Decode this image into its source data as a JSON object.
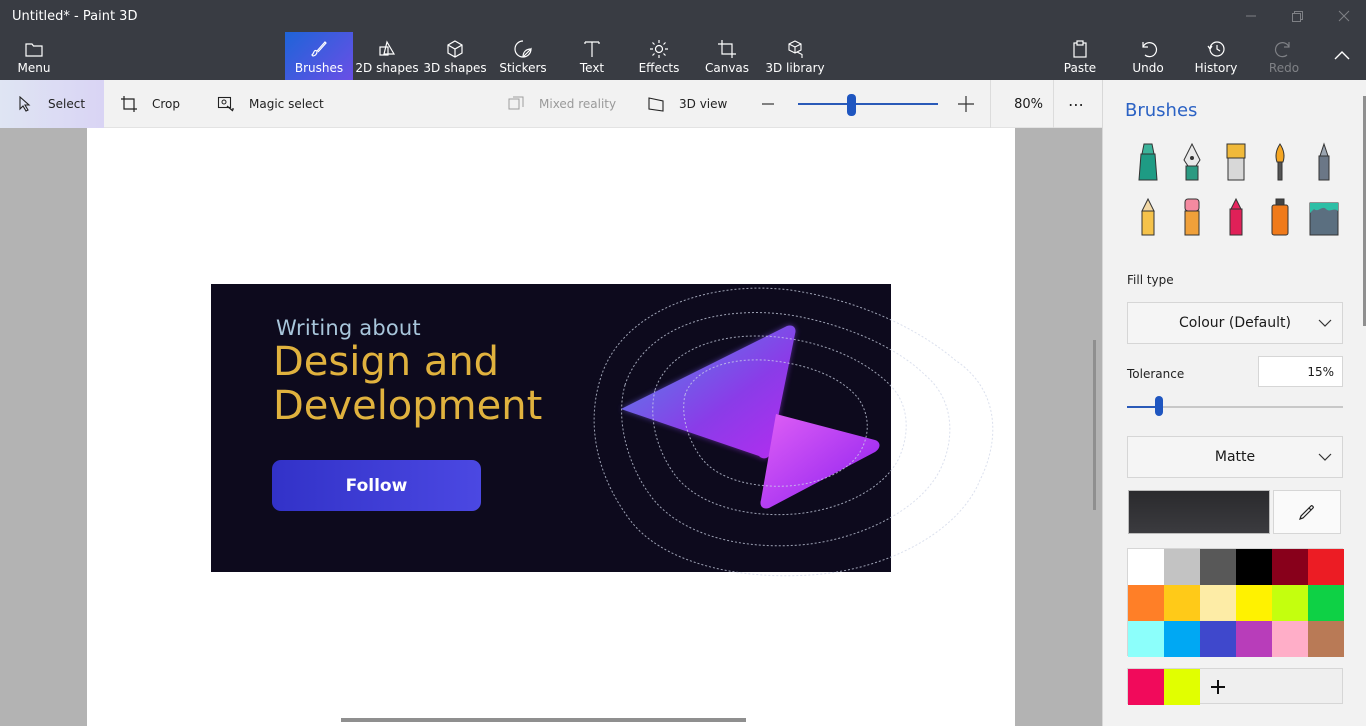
{
  "window": {
    "title": "Untitled* - Paint 3D"
  },
  "ribbon": {
    "menu": "Menu",
    "tools": [
      {
        "label": "Brushes",
        "icon": "brush-icon",
        "active": true
      },
      {
        "label": "2D shapes",
        "icon": "2d-shapes-icon"
      },
      {
        "label": "3D shapes",
        "icon": "3d-shapes-icon"
      },
      {
        "label": "Stickers",
        "icon": "stickers-icon"
      },
      {
        "label": "Text",
        "icon": "text-icon"
      },
      {
        "label": "Effects",
        "icon": "effects-icon"
      },
      {
        "label": "Canvas",
        "icon": "canvas-icon"
      },
      {
        "label": "3D library",
        "icon": "3d-library-icon"
      }
    ],
    "paste": "Paste",
    "undo": "Undo",
    "history": "History",
    "redo": "Redo"
  },
  "toolbar": {
    "select": "Select",
    "crop": "Crop",
    "magic_select": "Magic select",
    "mixed_reality": "Mixed reality",
    "view_3d": "3D view",
    "zoom": "80%",
    "zoom_level": 0.38
  },
  "banner": {
    "subtitle": "Writing about",
    "title_line1": "Design and",
    "title_line2": "Development",
    "button": "Follow"
  },
  "panel": {
    "title": "Brushes",
    "brushes": [
      "marker-icon",
      "calligraphy-pen-icon",
      "oil-brush-icon",
      "watercolor-icon",
      "pixel-pen-icon",
      "pencil-icon",
      "eraser-icon",
      "crayon-icon",
      "spray-can-icon",
      "fill-bucket-icon"
    ],
    "fill_type_label": "Fill type",
    "fill_type": "Colour (Default)",
    "tolerance_label": "Tolerance",
    "tolerance": "15%",
    "tolerance_level": 0.15,
    "finish": "Matte",
    "current_color": "#2a2a2d",
    "palette": [
      "#ffffff",
      "#c3c3c3",
      "#585858",
      "#000000",
      "#88001b",
      "#ec1c24",
      "#ff7f27",
      "#ffca18",
      "#fdeca6",
      "#fff200",
      "#c4ff0e",
      "#0ed145",
      "#8cfffb",
      "#00a8f3",
      "#3f48cc",
      "#b83dba",
      "#ffaec8",
      "#b97a56"
    ],
    "custom_colors": [
      "#f10a5b",
      "#e1ff00"
    ]
  }
}
